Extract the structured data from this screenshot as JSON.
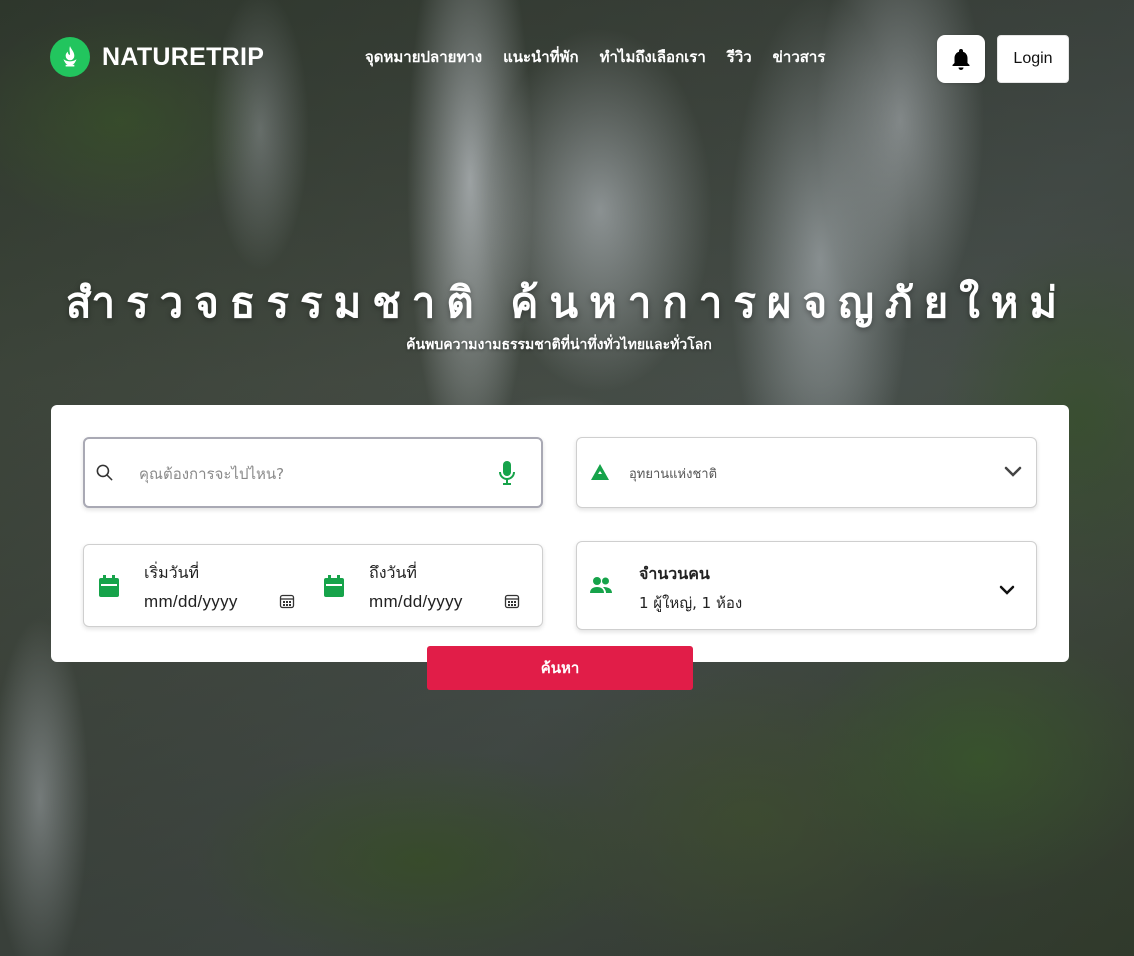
{
  "brand": {
    "name": "NATURETRIP",
    "logo_icon": "fire-leaf-icon",
    "color": "#22c55e"
  },
  "nav": {
    "links": [
      {
        "label": "จุดหมายปลายทาง"
      },
      {
        "label": "แนะนำที่พัก"
      },
      {
        "label": "ทำไมถึงเลือกเรา"
      },
      {
        "label": "รีวิว"
      },
      {
        "label": "ข่าวสาร"
      }
    ],
    "notification_icon": "bell-icon",
    "login_label": "Login"
  },
  "hero": {
    "title": "สำรวจธรรมชาติ ค้นหาการผจญภัยใหม่",
    "subtitle": "ค้นพบความงามธรรมชาติที่น่าทึ่งทั่วไทยและทั่วโลก"
  },
  "search": {
    "destination": {
      "placeholder": "คุณต้องการจะไปไหน?",
      "icon": "search-icon",
      "mic_icon": "microphone-icon"
    },
    "park": {
      "selected": "อุทยานแห่งชาติ",
      "icon": "mountain-icon"
    },
    "start_date": {
      "label": "เริ่มวันที่",
      "value": "mm/dd/yyyy"
    },
    "end_date": {
      "label": "ถึงวันที่",
      "value": "mm/dd/yyyy"
    },
    "guests": {
      "label": "จำนวนคน",
      "value": "1 ผู้ใหญ่,  1 ห้อง"
    },
    "submit_label": "ค้นหา",
    "accent_color": "#e11d48",
    "icon_color": "#16a34a"
  }
}
